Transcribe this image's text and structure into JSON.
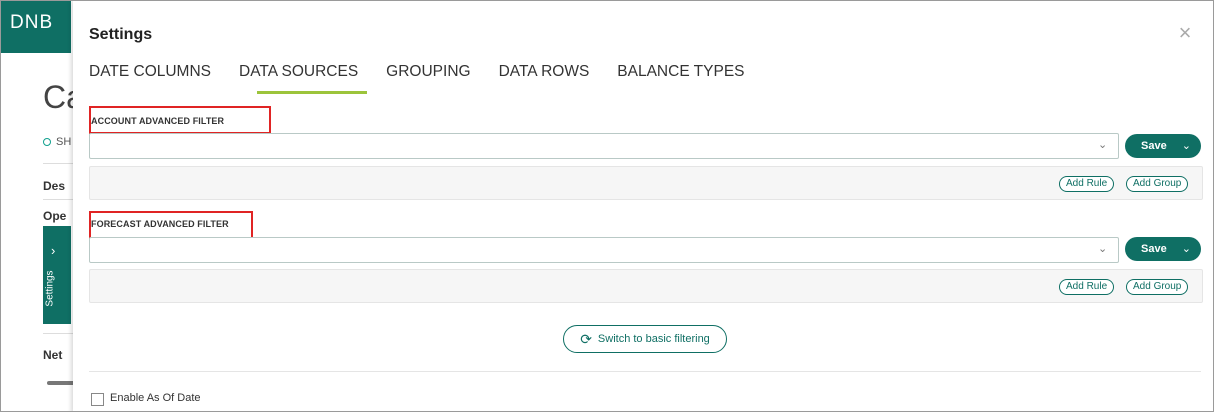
{
  "app": {
    "logo": "DNB",
    "bg_title": "Ca",
    "bg_pill_text": "SH",
    "bg_rows": [
      "Des",
      "Ope",
      "Net"
    ],
    "settings_tab": {
      "chevron": "›",
      "label": "Settings"
    }
  },
  "modal": {
    "title": "Settings",
    "close_icon": "×",
    "tabs": [
      {
        "label": "DATE COLUMNS"
      },
      {
        "label": "DATA SOURCES",
        "active": true
      },
      {
        "label": "GROUPING"
      },
      {
        "label": "DATA ROWS"
      },
      {
        "label": "BALANCE TYPES"
      }
    ],
    "account": {
      "label": "ACCOUNT ADVANCED FILTER",
      "select_value": "",
      "save_label": "Save",
      "add_rule": "Add Rule",
      "add_group": "Add Group"
    },
    "forecast": {
      "label": "FORECAST ADVANCED FILTER",
      "select_value": "",
      "save_label": "Save",
      "add_rule": "Add Rule",
      "add_group": "Add Group"
    },
    "switch_label": "Switch to basic filtering",
    "enable_as_of_date": "Enable As Of Date"
  },
  "colors": {
    "brand": "#0f6f64",
    "tab_underline": "#9cc43b",
    "highlight": "#e02424"
  },
  "icons": {
    "close": "close-icon",
    "caret": "chevron-down-icon",
    "refresh": "refresh-icon"
  }
}
